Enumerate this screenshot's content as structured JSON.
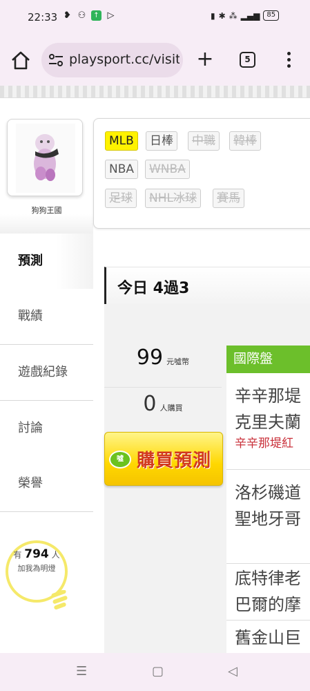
{
  "status": {
    "time": "22:33",
    "battery": "85"
  },
  "browser": {
    "url": "playsport.cc/visit",
    "tab_count": "5"
  },
  "profile": {
    "username": "狗狗王國"
  },
  "nav": [
    {
      "label": "預測"
    },
    {
      "label": "戰績"
    },
    {
      "label": "遊戲紀錄"
    },
    {
      "label": "討論"
    },
    {
      "label": "榮譽"
    }
  ],
  "lamp": {
    "prefix": "有",
    "count": "794",
    "suffix": "人",
    "line2": "加我為明燈"
  },
  "leagues": [
    "MLB",
    "日棒",
    "中職",
    "韓棒",
    "NBA",
    "WNBA",
    "足球",
    "NHL冰球",
    "賽馬"
  ],
  "record": {
    "text": "今日 4過3"
  },
  "purchase": {
    "price": "99",
    "price_unit": "元噓幣",
    "buyers": "0",
    "buyers_unit": "人購買",
    "button": "購買預測",
    "coin": "噓"
  },
  "games": {
    "header": "國際盤",
    "list": [
      {
        "line1": "辛辛那堤",
        "line2": "克里夫蘭",
        "pick": "辛辛那堤紅"
      },
      {
        "line1": "洛杉磯道",
        "line2": "聖地牙哥"
      },
      {
        "line1": "底特律老",
        "line2": "巴爾的摩"
      },
      {
        "line1": "舊金山巨"
      }
    ]
  }
}
